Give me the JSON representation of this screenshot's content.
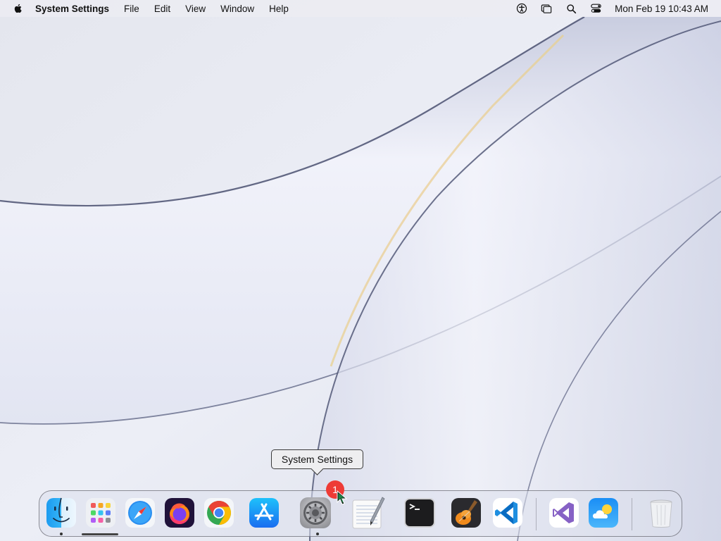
{
  "menubar": {
    "app_name": "System Settings",
    "menus": [
      "File",
      "Edit",
      "View",
      "Window",
      "Help"
    ],
    "clock": "Mon Feb 19  10:43 AM",
    "status_icons": [
      "accessibility-icon",
      "stage-manager-icon",
      "spotlight-search-icon",
      "control-center-icon"
    ]
  },
  "tooltip": {
    "text": "System Settings"
  },
  "dock": {
    "badge_count": "1",
    "items": [
      {
        "name": "finder",
        "running": true
      },
      {
        "name": "launchpad",
        "running": false
      },
      {
        "name": "safari",
        "running": false
      },
      {
        "name": "firefox",
        "running": false
      },
      {
        "name": "chrome",
        "running": false
      },
      {
        "name": "app-store",
        "running": false
      },
      {
        "name": "system-settings",
        "running": true
      },
      {
        "name": "textedit",
        "running": false
      },
      {
        "name": "terminal",
        "running": false
      },
      {
        "name": "garageband",
        "running": false
      },
      {
        "name": "vscode",
        "running": false
      },
      {
        "name": "visual-studio",
        "running": false
      },
      {
        "name": "weather",
        "running": false
      },
      {
        "name": "trash",
        "running": false
      }
    ]
  },
  "colors": {
    "badge": "#ee3b36",
    "menubar_bg": "#ebecf2",
    "wallpaper_base": "#e6e8f0"
  }
}
